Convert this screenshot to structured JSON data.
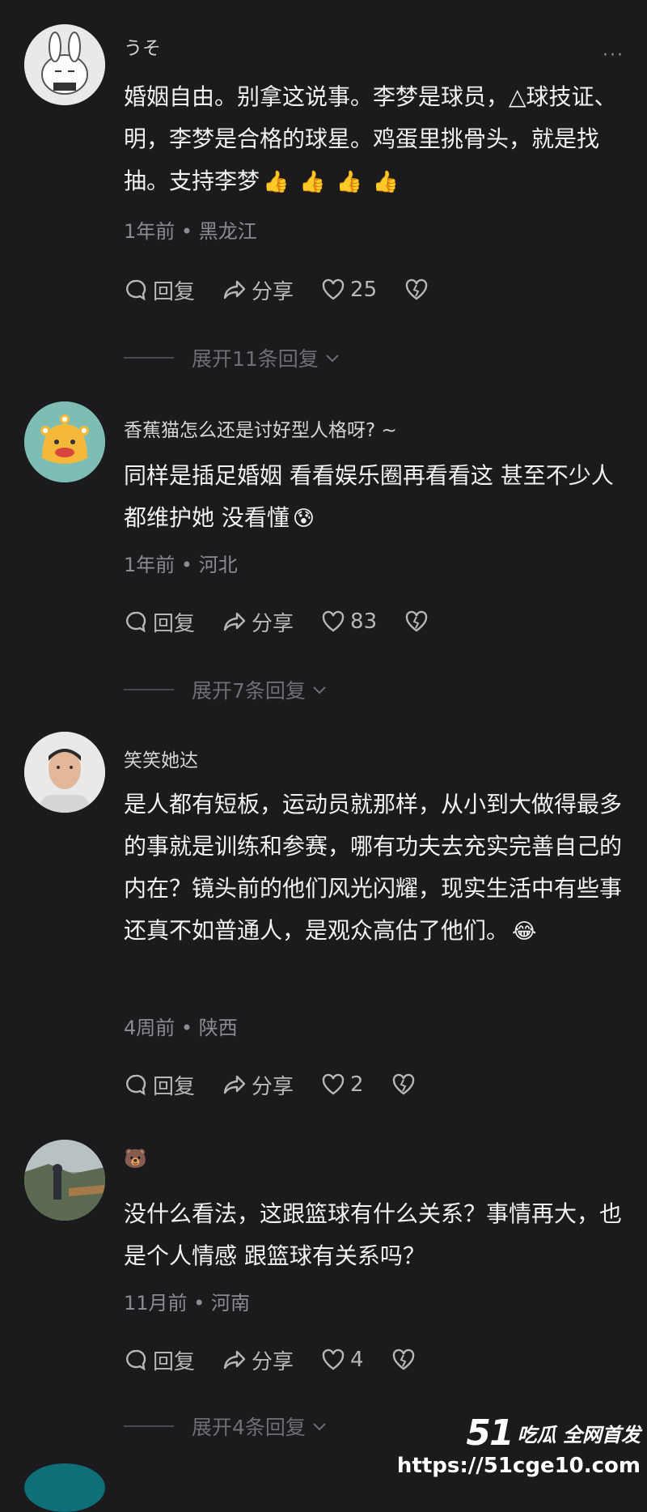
{
  "comments": [
    {
      "username": "うそ",
      "text": "婚姻自由。别拿这说事。李梦是球员，△球技证、明，李梦是合格的球星。鸡蛋里挑骨头，就是找抽。支持李梦",
      "emojis": [
        "👍",
        "👍",
        "👍",
        "👍"
      ],
      "time": "1年前",
      "location": "黑龙江",
      "reply_label": "回复",
      "share_label": "分享",
      "likes": "25",
      "expand_label": "展开11条回复"
    },
    {
      "username": "香蕉猫怎么还是讨好型人格呀? ~",
      "text": "同样是插足婚姻 看看娱乐圈再看看这 甚至不少人都维护她 没看懂",
      "emojis": [
        "😰"
      ],
      "time": "1年前",
      "location": "河北",
      "reply_label": "回复",
      "share_label": "分享",
      "likes": "83",
      "expand_label": "展开7条回复"
    },
    {
      "username": "笑笑她达",
      "text": "是人都有短板，运动员就那样，从小到大做得最多的事就是训练和参赛，哪有功夫去充实完善自己的内在？镜头前的他们风光闪耀，现实生活中有些事还真不如普通人，是观众高估了他们。",
      "emojis": [
        "😂"
      ],
      "time": "4周前",
      "location": "陕西",
      "reply_label": "回复",
      "share_label": "分享",
      "likes": "2"
    },
    {
      "username": "🐻",
      "text": "没什么看法，这跟篮球有什么关系？事情再大，也是个人情感 跟篮球有关系吗？",
      "time": "11月前",
      "location": "河南",
      "reply_label": "回复",
      "share_label": "分享",
      "likes": "4",
      "expand_label": "展开4条回复"
    }
  ],
  "more_icon": "···",
  "meta_separator": " • ",
  "watermark": {
    "brand_number": "51",
    "brand_text": "吃瓜 全网首发",
    "url": "https://51cge10.com"
  }
}
